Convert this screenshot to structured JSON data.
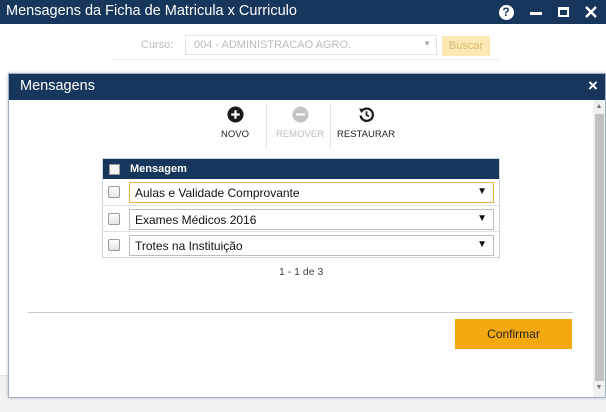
{
  "window": {
    "title": "Mensagens da Ficha de Matricula x Curriculo",
    "help_label": "?"
  },
  "background": {
    "curso_label": "Curso:",
    "curso_value": "004 - ADMINISTRACAO AGRO.",
    "buscar_label": "Buscar"
  },
  "modal": {
    "title": "Mensagens",
    "close_label": "×",
    "toolbar": {
      "novo_label": "NOVO",
      "remover_label": "REMOVER",
      "restaurar_label": "RESTAURAR"
    },
    "table": {
      "header": "Mensagem",
      "rows": [
        {
          "value": "Aulas e Validade Comprovante"
        },
        {
          "value": "Exames Médicos 2016"
        },
        {
          "value": "Trotes na Instituição"
        }
      ]
    },
    "pager": "1 - 1 de 3",
    "confirm_label": "Confirmar"
  },
  "colors": {
    "header_bg": "#16365c",
    "accent": "#f5a911"
  }
}
